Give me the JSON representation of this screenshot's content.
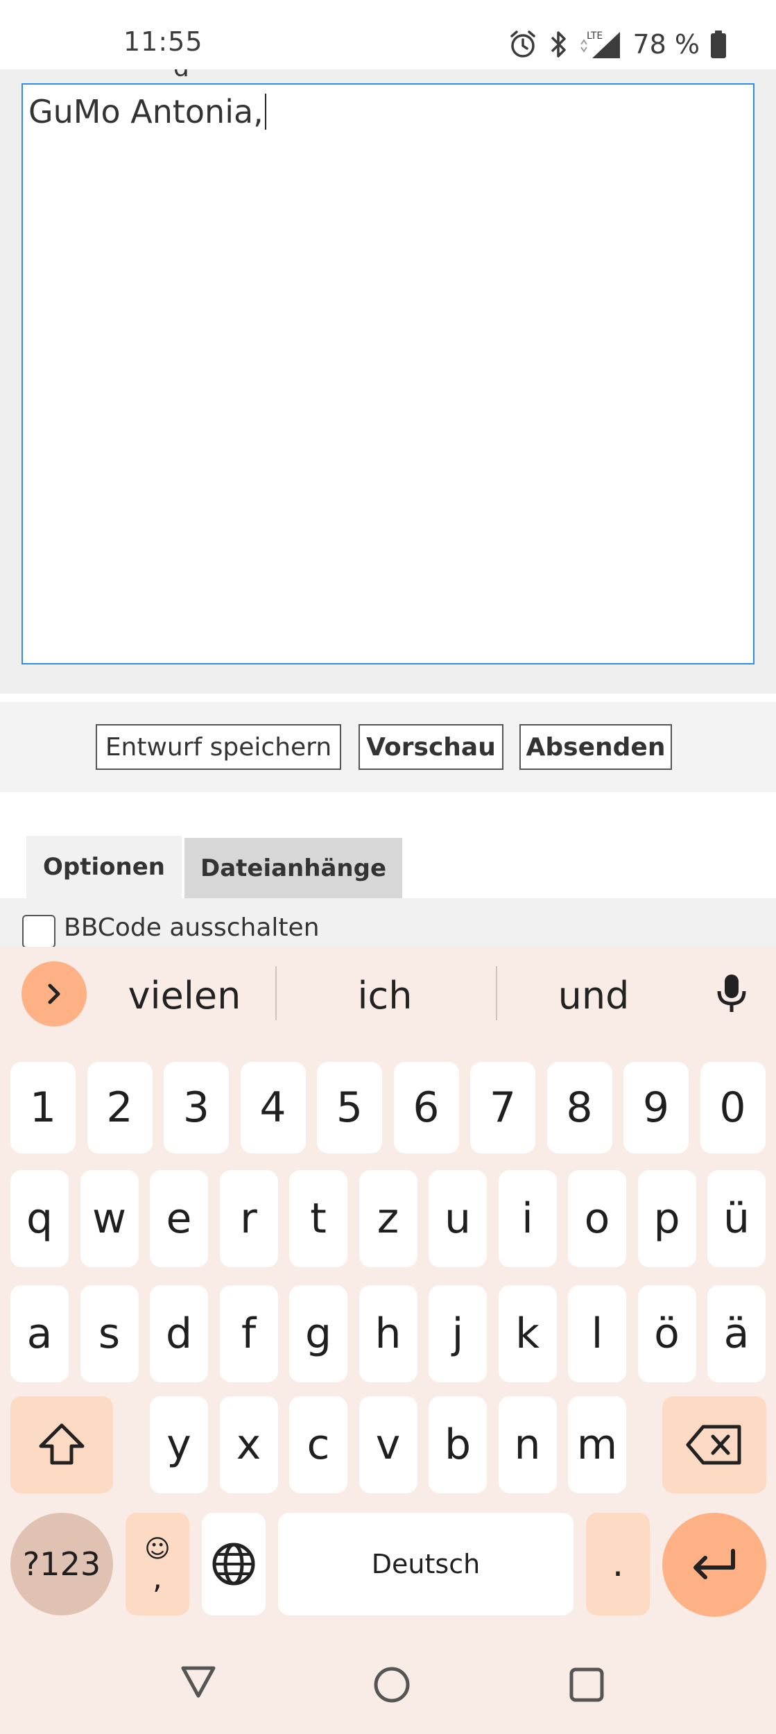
{
  "status_bar": {
    "time": "11:55",
    "battery_percent": "78 %",
    "icons": [
      "alarm-icon",
      "bluetooth-icon",
      "lte-signal-icon",
      "battery-icon"
    ]
  },
  "editor": {
    "message_text": "GuMo Antonia,"
  },
  "buttons": {
    "save_draft": "Entwurf speichern",
    "preview": "Vorschau",
    "submit": "Absenden"
  },
  "tabs": [
    {
      "label": "Optionen",
      "active": true
    },
    {
      "label": "Dateianhänge",
      "active": false
    }
  ],
  "options": {
    "disable_bbcode_label": "BBCode ausschalten",
    "disable_bbcode_checked": false
  },
  "keyboard": {
    "suggestions": [
      "vielen",
      "ich",
      "und"
    ],
    "rows": [
      [
        "1",
        "2",
        "3",
        "4",
        "5",
        "6",
        "7",
        "8",
        "9",
        "0"
      ],
      [
        "q",
        "w",
        "e",
        "r",
        "t",
        "z",
        "u",
        "i",
        "o",
        "p",
        "ü"
      ],
      [
        "a",
        "s",
        "d",
        "f",
        "g",
        "h",
        "j",
        "k",
        "l",
        "ö",
        "ä"
      ],
      [
        "y",
        "x",
        "c",
        "v",
        "b",
        "n",
        "m"
      ]
    ],
    "symbols_label": "?123",
    "emoji_label": "☺",
    "comma_label": ",",
    "space_label": "Deutsch",
    "period_label": ".",
    "accent_color": "#fdb185",
    "background_color": "#f9ebe6"
  },
  "nav_bar": {
    "icons": [
      "back-icon",
      "home-icon",
      "recents-icon"
    ]
  }
}
